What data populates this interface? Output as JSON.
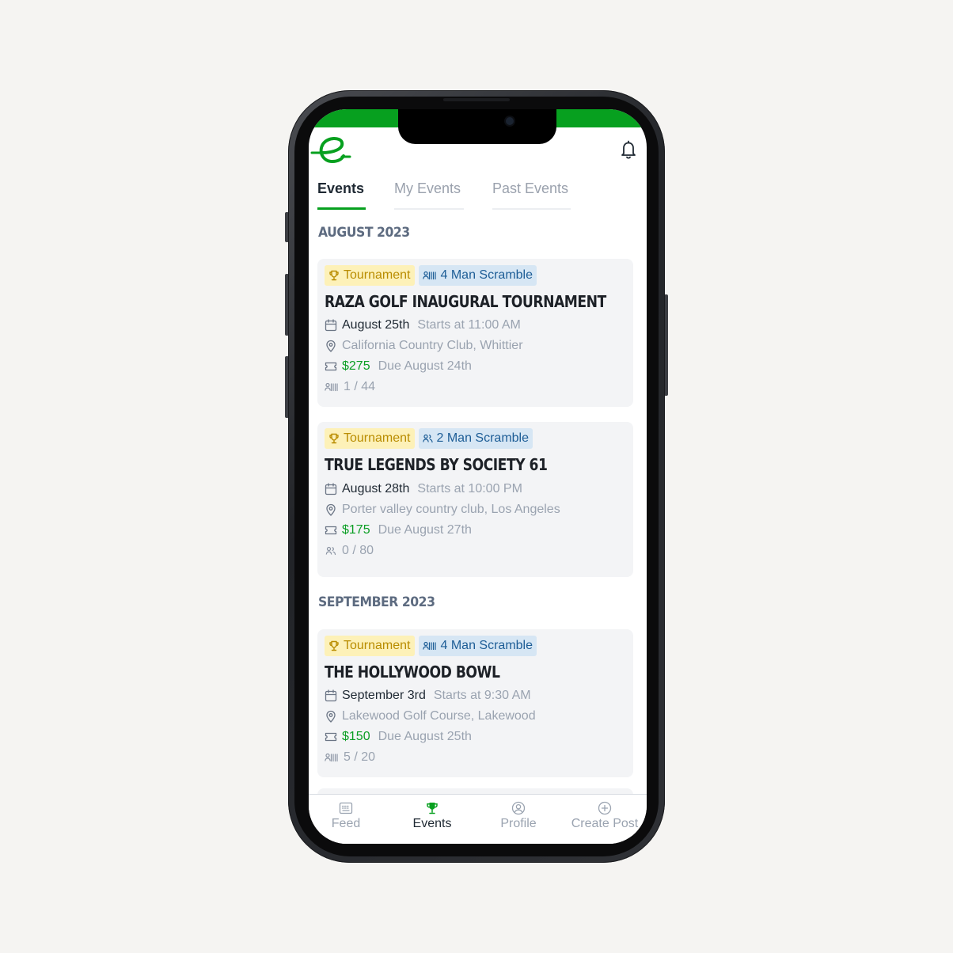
{
  "colors": {
    "brand_green": "#07a01f",
    "price_green": "#0a9e23",
    "tournament_bg": "#fdf1b8",
    "format_bg": "#d6e6f4"
  },
  "header": {
    "logo_icon": "app-logo-icon",
    "notification_icon": "bell-icon"
  },
  "tabs": [
    {
      "label": "Events",
      "active": true
    },
    {
      "label": "My Events",
      "active": false
    },
    {
      "label": "Past Events",
      "active": false
    }
  ],
  "sections": [
    {
      "month": "AUGUST 2023",
      "events": [
        {
          "type": "Tournament",
          "format": "4 Man Scramble",
          "title": "RAZA GOLF INAUGURAL TOURNAMENT",
          "date": "August 25th",
          "start": "Starts at 11:00 AM",
          "location": "California Country Club, Whittier",
          "price": "$275",
          "due": "Due August 24th",
          "capacity": "1 / 44"
        },
        {
          "type": "Tournament",
          "format": "2 Man Scramble",
          "title": "TRUE LEGENDS BY SOCIETY 61",
          "date": "August 28th",
          "start": "Starts at 10:00 PM",
          "location": "Porter valley country club, Los Angeles",
          "price": "$175",
          "due": "Due August 27th",
          "capacity": "0 / 80"
        }
      ]
    },
    {
      "month": "SEPTEMBER 2023",
      "events": [
        {
          "type": "Tournament",
          "format": "4 Man Scramble",
          "title": "THE HOLLYWOOD BOWL",
          "date": "September 3rd",
          "start": "Starts at 9:30 AM",
          "location": "Lakewood Golf Course, Lakewood",
          "price": "$150",
          "due": "Due August 25th",
          "capacity": "5 / 20"
        }
      ]
    }
  ],
  "bottom_nav": [
    {
      "label": "Feed",
      "icon": "feed-icon",
      "active": false
    },
    {
      "label": "Events",
      "icon": "trophy-icon",
      "active": true
    },
    {
      "label": "Profile",
      "icon": "profile-icon",
      "active": false
    },
    {
      "label": "Create Post",
      "icon": "plus-circle-icon",
      "active": false
    }
  ]
}
